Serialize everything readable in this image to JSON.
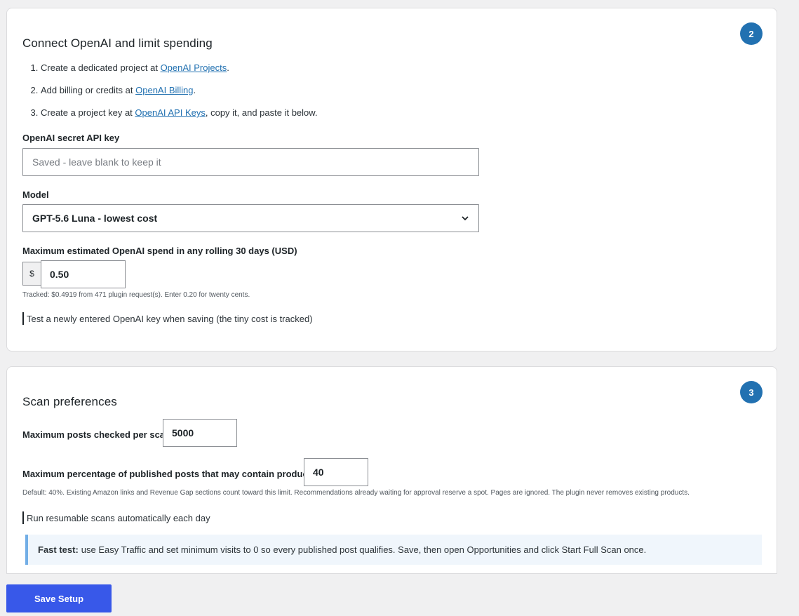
{
  "step2": {
    "badge": "2",
    "title": "Connect OpenAI and limit spending",
    "steps": [
      {
        "before": "Create a dedicated project at ",
        "link": "OpenAI Projects",
        "after": "."
      },
      {
        "before": "Add billing or credits at ",
        "link": "OpenAI Billing",
        "after": "."
      },
      {
        "before": "Create a project key at ",
        "link": "OpenAI API Keys",
        "after": ", copy it, and paste it below."
      }
    ],
    "api_key_label": "OpenAI secret API key",
    "api_key_placeholder": "Saved - leave blank to keep it",
    "model_label": "Model",
    "model_selected": "GPT-5.6 Luna - lowest cost",
    "spend_label": "Maximum estimated OpenAI spend in any rolling 30 days (USD)",
    "currency_symbol": "$",
    "spend_value": "0.50",
    "spend_help": "Tracked: $0.4919 from 471 plugin request(s). Enter 0.20 for twenty cents.",
    "test_key_label": "Test a newly entered OpenAI key when saving (the tiny cost is tracked)"
  },
  "step3": {
    "badge": "3",
    "title": "Scan preferences",
    "max_posts_label": "Maximum posts checked per scan",
    "max_posts_value": "5000",
    "max_pct_label": "Maximum percentage of published posts that may contain products",
    "max_pct_value": "40",
    "max_pct_help": "Default: 40%. Existing Amazon links and Revenue Gap sections count toward this limit. Recommendations already waiting for approval reserve a spot. Pages are ignored. The plugin never removes existing products.",
    "auto_scan_label": "Run resumable scans automatically each day",
    "notice_strong": "Fast test:",
    "notice_text": "use Easy Traffic and set minimum visits to 0 so every published post qualifies. Save, then open Opportunities and click Start Full Scan once."
  },
  "save_button": "Save Setup",
  "colors": {
    "accent": "#2271b1",
    "button": "#3858e9",
    "notice_border": "#72aee6"
  },
  "icons": {
    "select": "chevron-down-icon"
  }
}
